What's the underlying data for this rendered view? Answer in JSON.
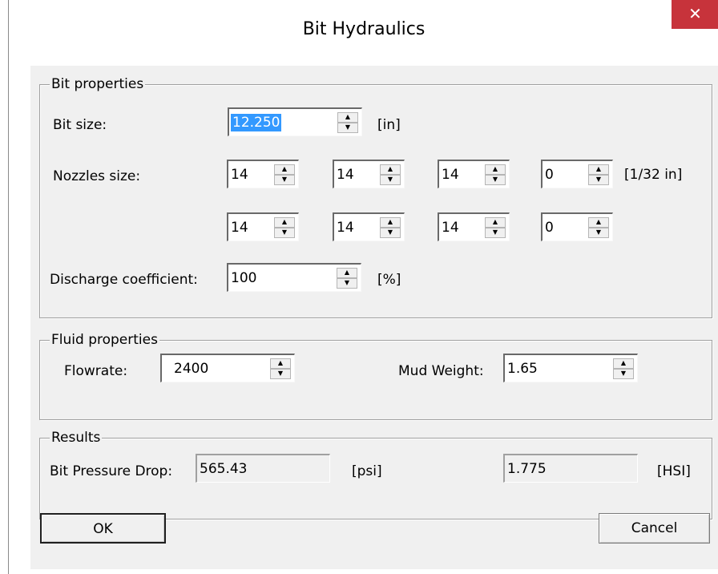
{
  "window": {
    "title": "Bit Hydraulics",
    "close_glyph": "✕"
  },
  "bit_properties": {
    "legend": "Bit properties",
    "bit_size_label": "Bit size:",
    "bit_size_value": "12.250",
    "bit_size_unit": "[in]",
    "nozzles_label": "Nozzles size:",
    "nozzles_row1": [
      "14",
      "14",
      "14",
      "0"
    ],
    "nozzles_row2": [
      "14",
      "14",
      "14",
      "0"
    ],
    "nozzles_unit": "[1/32 in]",
    "discharge_label": "Discharge coefficient:",
    "discharge_value": "100",
    "discharge_unit": "[%]"
  },
  "fluid_properties": {
    "legend": "Fluid properties",
    "flowrate_label": "Flowrate:",
    "flowrate_value": "2400",
    "mud_weight_label": "Mud Weight:",
    "mud_weight_value": "1.65"
  },
  "results": {
    "legend": "Results",
    "pressure_drop_label": "Bit Pressure Drop:",
    "pressure_drop_value": "565.43",
    "pressure_drop_unit": "[psi]",
    "hsi_value": "1.775",
    "hsi_unit": "[HSI]"
  },
  "buttons": {
    "ok": "OK",
    "cancel": "Cancel"
  },
  "icons": {
    "spin_up": "spin-up-arrow-icon",
    "spin_down": "spin-down-arrow-icon",
    "close": "close-icon"
  }
}
